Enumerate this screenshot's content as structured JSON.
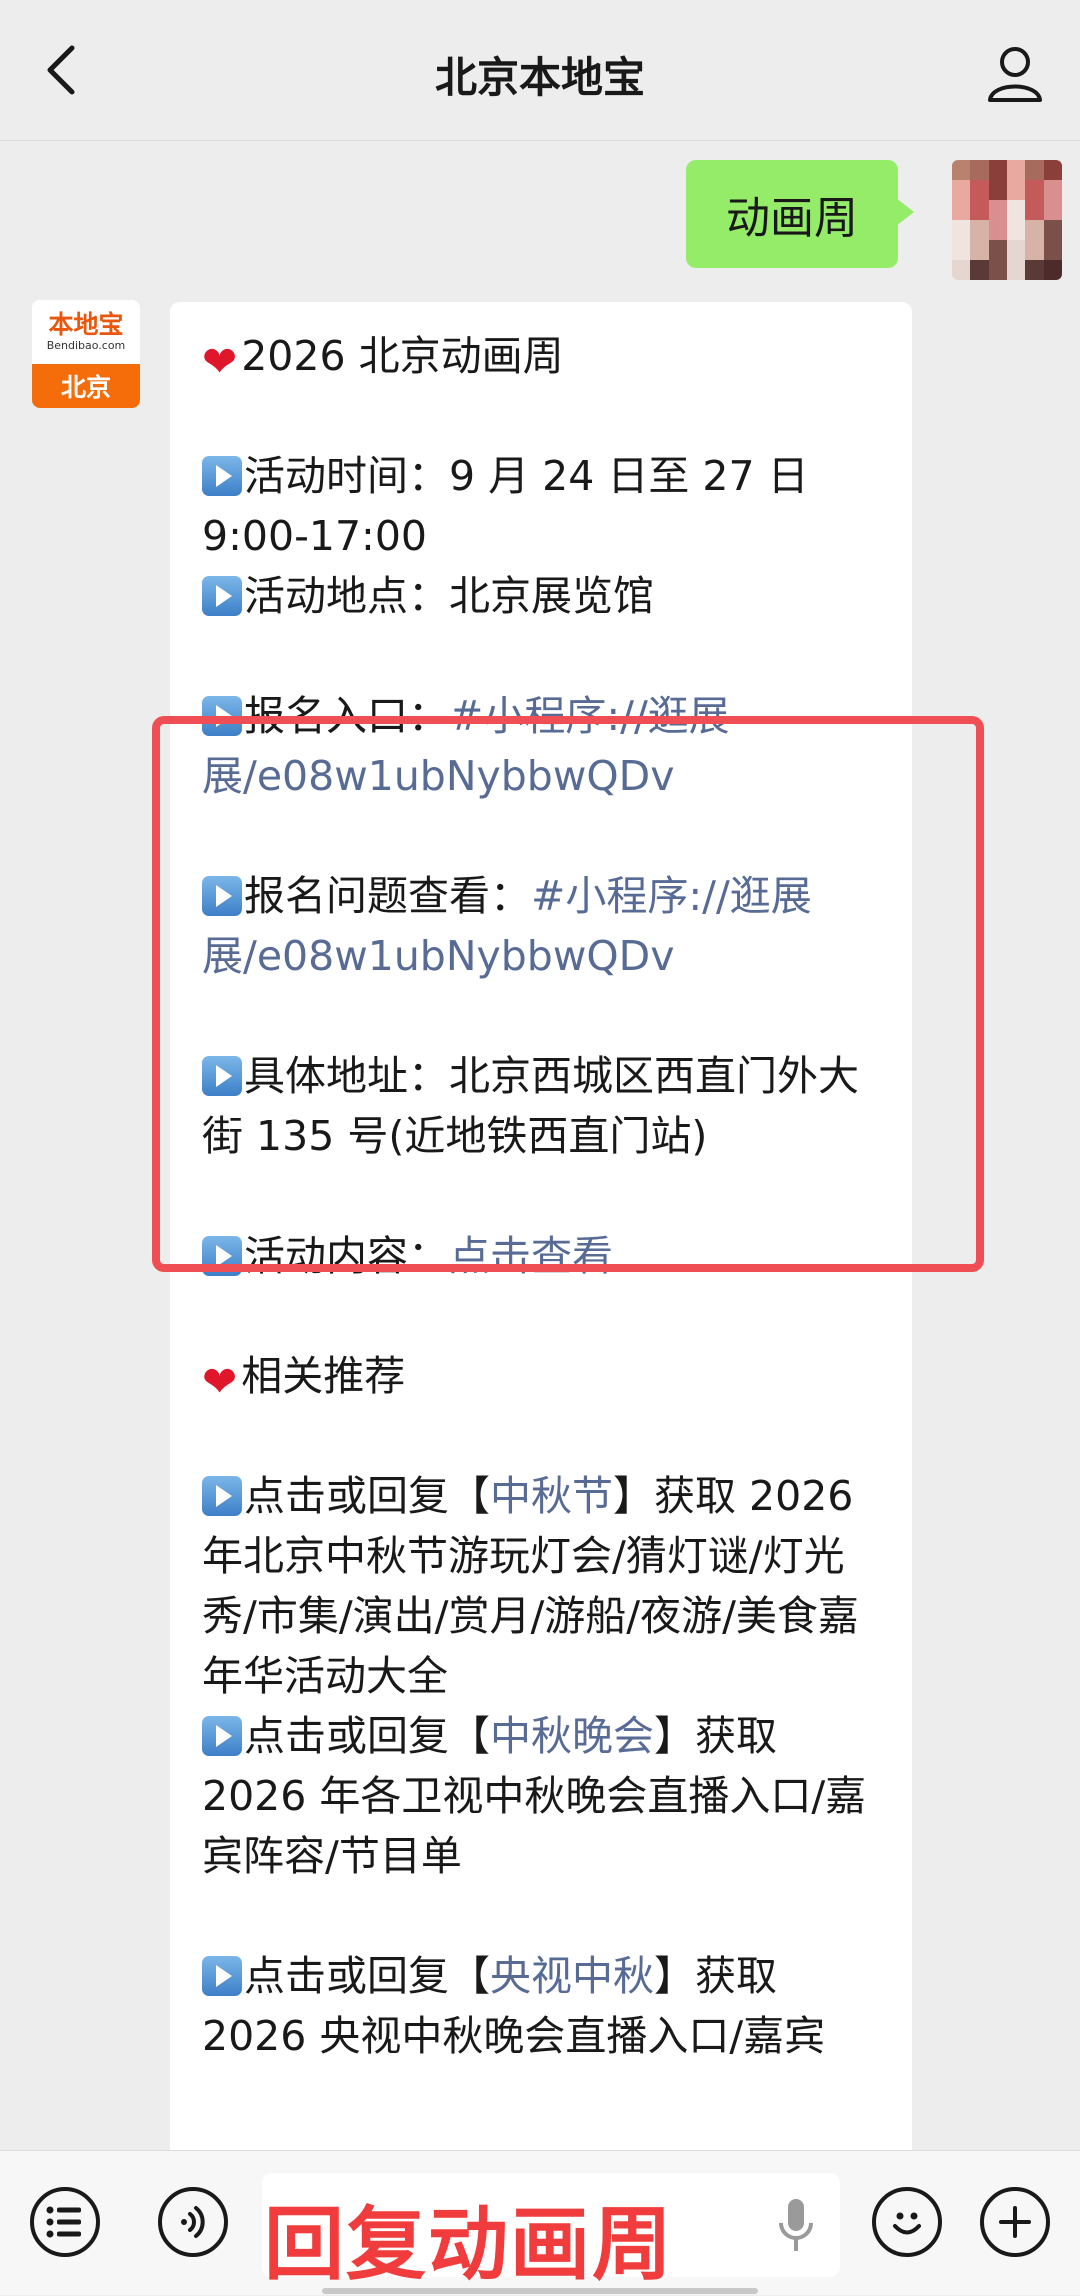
{
  "header": {
    "title": "北京本地宝"
  },
  "outgoing": {
    "text": "动画周"
  },
  "bot": {
    "brand": "本地宝",
    "site": "Bendibao.com",
    "city": "北京"
  },
  "messages": [
    {
      "icon": "heart",
      "text": "2026 北京动画周"
    },
    {
      "icon": "play",
      "text": "活动时间：9 月 24 日至 27 日 9:00-17:00"
    },
    {
      "icon": "play",
      "text": "活动地点：北京展览馆"
    },
    {
      "icon": "play",
      "text": "报名入口：",
      "link": "#小程序://逛展展/e08w1ubNybbwQDv"
    },
    {
      "icon": "play",
      "text": "报名问题查看：",
      "link": "#小程序://逛展展/e08w1ubNybbwQDv"
    },
    {
      "icon": "play",
      "text": "具体地址：北京西城区西直门外大街 135 号(近地铁西直门站)"
    },
    {
      "icon": "play",
      "text": "活动内容：",
      "link": "点击查看"
    },
    {
      "icon": "heart",
      "text": "相关推荐"
    },
    {
      "icon": "play",
      "pre": "点击或回复【",
      "link": "中秋节",
      "post": "】获取 2026 年北京中秋节游玩灯会/猜灯谜/灯光秀/市集/演出/赏月/游船/夜游/美食嘉年华活动大全"
    },
    {
      "icon": "play",
      "pre": "点击或回复【",
      "link": "中秋晚会",
      "post": "】获取 2026 年各卫视中秋晚会直播入口/嘉宾阵容/节目单"
    },
    {
      "icon": "play",
      "pre": "点击或回复【",
      "link": "央视中秋",
      "post": "】获取 2026 央视中秋晚会直播入口/嘉宾"
    }
  ],
  "overlay": {
    "text": "回复动画周"
  },
  "colors": {
    "accent_red": "#f04e55",
    "link": "#576b95",
    "bubble_green": "#95ec69"
  }
}
